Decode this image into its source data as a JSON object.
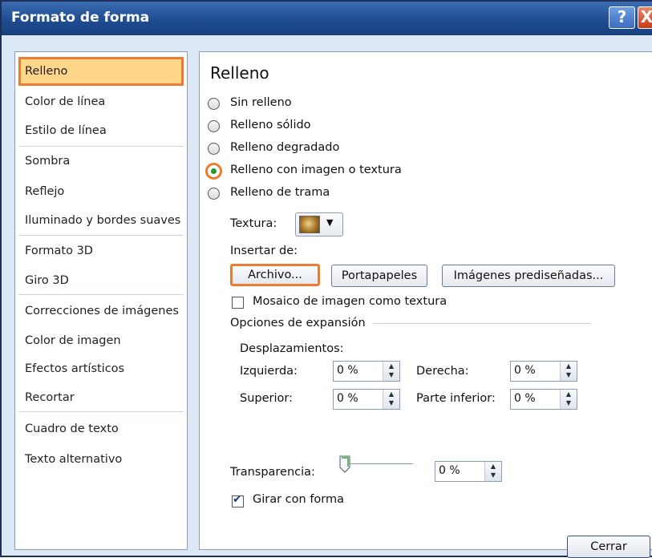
{
  "window": {
    "title": "Formato de forma",
    "help_glyph": "?",
    "close_glyph": "X"
  },
  "nav": {
    "items": [
      {
        "label": "Relleno",
        "selected": true
      },
      {
        "label": "Color de línea"
      },
      {
        "label": "Estilo de línea"
      },
      {
        "label": "Sombra"
      },
      {
        "label": "Reflejo"
      },
      {
        "label": "Iluminado y bordes suaves"
      },
      {
        "label": "Formato 3D"
      },
      {
        "label": "Giro 3D"
      },
      {
        "label": "Correcciones de imágenes"
      },
      {
        "label": "Color de imagen"
      },
      {
        "label": "Efectos artísticos"
      },
      {
        "label": "Recortar"
      },
      {
        "label": "Cuadro de texto"
      },
      {
        "label": "Texto alternativo"
      }
    ]
  },
  "panel": {
    "heading": "Relleno",
    "fill_options": [
      {
        "label": "Sin relleno",
        "selected": false
      },
      {
        "label": "Relleno sólido",
        "selected": false
      },
      {
        "label": "Relleno degradado",
        "selected": false
      },
      {
        "label": "Relleno con imagen o textura",
        "selected": true
      },
      {
        "label": "Relleno de trama",
        "selected": false
      }
    ],
    "texture_label": "Textura:",
    "insert_from_label": "Insertar de:",
    "buttons": {
      "file": "Archivo...",
      "clipboard": "Portapapeles",
      "clipart": "Imágenes prediseñadas..."
    },
    "tile_checkbox": {
      "label": "Mosaico de imagen como textura",
      "checked": false
    },
    "stretch_options_label": "Opciones de expansión",
    "offsets_label": "Desplazamientos:",
    "offsets": {
      "left": {
        "label": "Izquierda:",
        "value": "0 %"
      },
      "right": {
        "label": "Derecha:",
        "value": "0 %"
      },
      "top": {
        "label": "Superior:",
        "value": "0 %"
      },
      "bottom": {
        "label": "Parte inferior:",
        "value": "0 %"
      }
    },
    "transparency": {
      "label": "Transparencia:",
      "value": "0 %",
      "level": 0
    },
    "rotate_checkbox": {
      "label": "Girar con forma",
      "checked": true
    }
  },
  "footer": {
    "close_label": "Cerrar"
  },
  "colors": {
    "accent_highlight": "#ed7c31",
    "selected_fill": "#ffd68a",
    "titlebar": "#1f4d91"
  }
}
